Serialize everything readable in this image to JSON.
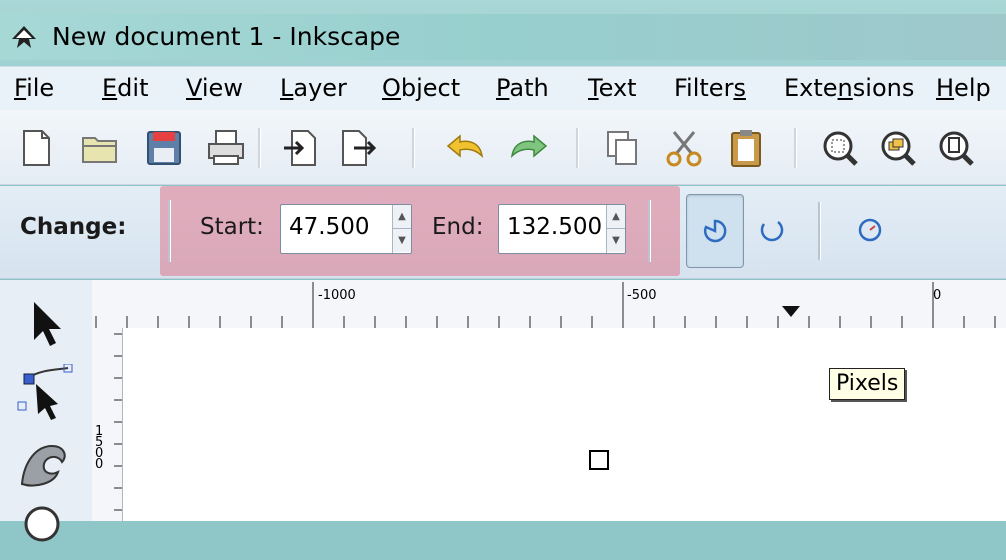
{
  "window": {
    "title": "New document 1 - Inkscape"
  },
  "menu": [
    {
      "label": "File"
    },
    {
      "label": "Edit"
    },
    {
      "label": "View"
    },
    {
      "label": "Layer"
    },
    {
      "label": "Object"
    },
    {
      "label": "Path"
    },
    {
      "label": "Text"
    },
    {
      "label": "Filters"
    },
    {
      "label": "Extensions"
    },
    {
      "label": "Help"
    }
  ],
  "toolbar": {
    "icons": [
      "new-document-icon",
      "open-icon",
      "save-icon",
      "print-icon",
      "import-icon",
      "export-icon",
      "undo-icon",
      "redo-icon",
      "duplicate-icon",
      "cut-icon",
      "paste-icon",
      "zoom-selection-icon",
      "zoom-drawing-icon",
      "zoom-page-icon"
    ]
  },
  "tool_controls": {
    "change_label": "Change:",
    "start_label": "Start:",
    "start_value": "47.500",
    "end_label": "End:",
    "end_value": "132.500",
    "highlight_color": "#dc788c"
  },
  "rulers": {
    "h_labels": [
      "-1000",
      "-500",
      "0"
    ],
    "v_digits": [
      "1",
      "5",
      "0",
      "0"
    ]
  },
  "tooltip": {
    "text": "Pixels"
  }
}
